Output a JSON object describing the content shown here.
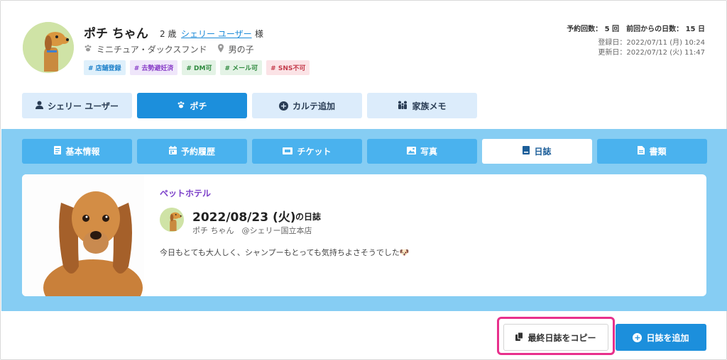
{
  "pet": {
    "name": "ポチ ちゃん",
    "age": "2 歳",
    "owner": "シェリー ユーザー",
    "honorific": "様",
    "breed": "ミニチュア・ダックスフンド",
    "sex": "男の子",
    "tags": [
      "# 店舗登録",
      "# 去勢避妊済",
      "# DM可",
      "# メール可",
      "# SNS不可"
    ]
  },
  "stats": {
    "summary": "予約回数： 5 回　前回からの日数： 15 日",
    "registered": "登録日：2022/07/11 (月) 10:24",
    "updated": "更新日：2022/07/12 (火) 11:47"
  },
  "top_tabs": [
    {
      "label": "シェリー ユーザー",
      "icon": "user-icon"
    },
    {
      "label": "ポチ",
      "icon": "paw-icon"
    },
    {
      "label": "カルテ追加",
      "icon": "plus-circle-icon"
    },
    {
      "label": "家族メモ",
      "icon": "family-icon"
    }
  ],
  "sub_tabs": [
    {
      "label": "基本情報",
      "icon": "document-icon"
    },
    {
      "label": "予約履歴",
      "icon": "calendar-icon"
    },
    {
      "label": "チケット",
      "icon": "ticket-icon"
    },
    {
      "label": "写真",
      "icon": "image-icon"
    },
    {
      "label": "日誌",
      "icon": "book-icon"
    },
    {
      "label": "書類",
      "icon": "file-icon"
    }
  ],
  "diary": {
    "category": "ペットホテル",
    "date": "2022/08/23 (火)",
    "suffix": "の日誌",
    "author": "ポチ ちゃん　@シェリー国立本店",
    "body": "今日もとても大人しく、シャンプーもとっても気持ちよさそうでした🐶"
  },
  "actions": {
    "copy_label": "最終日誌をコピー",
    "add_label": "日誌を追加"
  },
  "colors": {
    "primary": "#1c8fdc",
    "band": "#86cdf3",
    "highlight": "#e8308c"
  }
}
